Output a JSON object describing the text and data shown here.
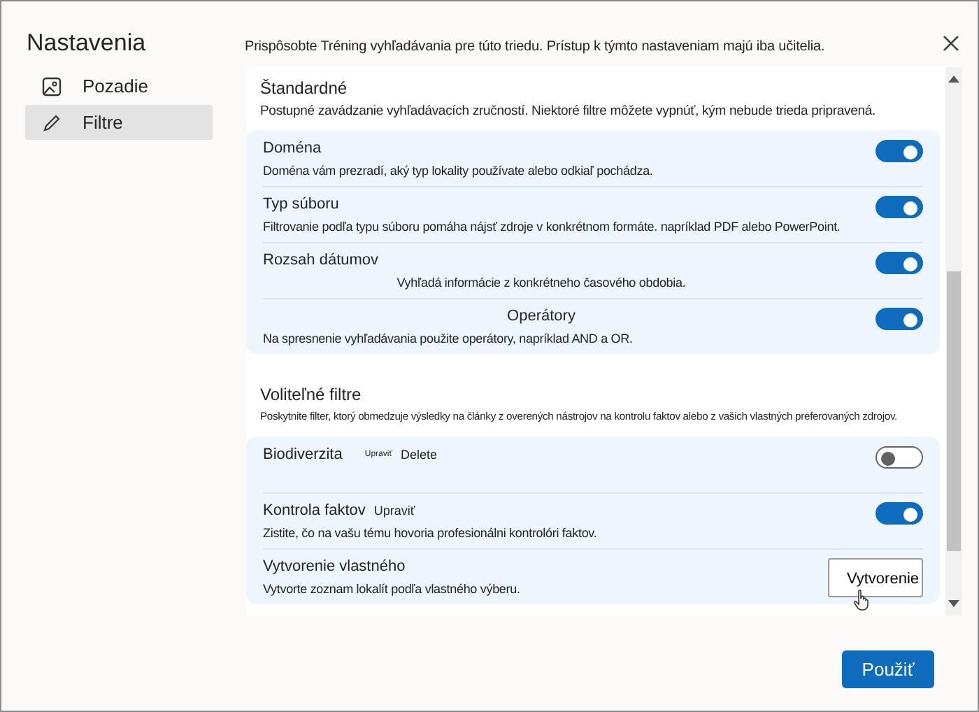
{
  "sidebar": {
    "title": "Nastavenia",
    "items": [
      {
        "label": "Pozadie",
        "selected": false
      },
      {
        "label": "Filtre",
        "selected": true
      }
    ]
  },
  "intro": "Prispôsobte Tréning vyhľadávania pre túto triedu. Prístup k týmto nastaveniam majú iba učitelia.",
  "sections": [
    {
      "heading": "Štandardné",
      "description": "Postupné zavádzanie vyhľadávacích zručností. Niektoré filtre môžete vypnúť, kým nebude trieda pripravená.",
      "small": false,
      "rows": [
        {
          "kind": "toggle",
          "label": "Doména",
          "description": "Doména vám prezradí, aký typ lokality používate alebo odkiaľ pochádza.",
          "on": true
        },
        {
          "kind": "toggle",
          "label": "Typ súboru",
          "description": "Filtrovanie podľa typu súboru pomáha nájsť zdroje v konkrétnom formáte. napríklad PDF alebo PowerPoint.",
          "on": true
        },
        {
          "kind": "toggle",
          "label": "Rozsah dátumov",
          "description": "Vyhľadá informácie z konkrétneho časového obdobia.",
          "description_centered": true,
          "on": true
        },
        {
          "kind": "toggle",
          "label": "Operátory",
          "label_centered": true,
          "description": "Na spresnenie vyhľadávania použite operátory, napríklad AND a OR.",
          "on": true
        }
      ]
    },
    {
      "heading": "Voliteľné filtre",
      "description": "Poskytnite filter, ktorý obmedzuje výsledky na články z overených nástrojov na kontrolu faktov alebo z vašich vlastných preferovaných zdrojov.",
      "small": true,
      "rows": [
        {
          "kind": "toggle",
          "label": "Biodiverzita",
          "links": [
            {
              "text": "Upraviť",
              "tiny": true
            },
            {
              "text": "Delete",
              "tiny": false
            }
          ],
          "on": false
        },
        {
          "kind": "toggle",
          "label": "Kontrola faktov",
          "links": [
            {
              "text": "Upraviť",
              "tiny": false
            }
          ],
          "description": "Zistite, čo na vašu tému hovoria profesionálni kontrolóri faktov.",
          "on": true
        },
        {
          "kind": "button",
          "label": "Vytvorenie vlastného",
          "description": "Vytvorte zoznam lokalít podľa vlastného výberu.",
          "button": "Vytvorenie"
        }
      ]
    }
  ],
  "apply_button": "Použiť"
}
